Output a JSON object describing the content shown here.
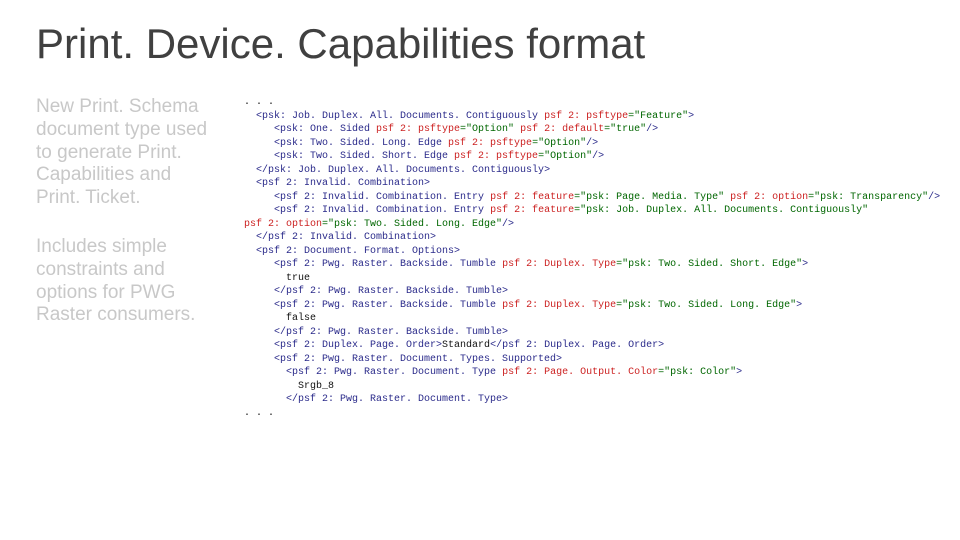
{
  "title": "Print. Device. Capabilities format",
  "left": {
    "p1": "New Print. Schema document type used to generate Print. Capabilities and Print. Ticket.",
    "p2": "Includes simple constraints and options for PWG Raster consumers."
  },
  "code": {
    "l00": ". . .",
    "l01_open": "<psk: Job. Duplex. All. Documents. Contiguously",
    "l01_a1n": " psf 2: psftype",
    "l01_a1v": "=\"Feature\"",
    "l02_open": "<psk: One. Sided",
    "l02_a1n": " psf 2: psftype",
    "l02_a1v": "=\"Option\"",
    "l02_a2n": " psf 2: default",
    "l02_a2v": "=\"true\"",
    "l03_open": "<psk: Two. Sided. Long. Edge",
    "l03_a1n": " psf 2: psftype",
    "l03_a1v": "=\"Option\"",
    "l04_open": "<psk: Two. Sided. Short. Edge",
    "l04_a1n": " psf 2: psftype",
    "l04_a1v": "=\"Option\"",
    "l05": "</psk: Job. Duplex. All. Documents. Contiguously>",
    "l06": "<psf 2: Invalid. Combination>",
    "l07_open": "<psf 2: Invalid. Combination. Entry",
    "l07_a1n": " psf 2: feature",
    "l07_a1v": "=\"psk: Page. Media. Type\"",
    "l07_a2n": " psf 2: option",
    "l07_a2v": "=\"psk: Transparency\"",
    "l08_open": "<psf 2: Invalid. Combination. Entry",
    "l08_a1n": " psf 2: feature",
    "l08_a1v": "=\"psk: Job. Duplex. All. Documents. Contiguously\"",
    "l08b_a1n": "psf 2: option",
    "l08b_a1v": "=\"psk: Two. Sided. Long. Edge\"",
    "l09": "</psf 2: Invalid. Combination>",
    "l10": "<psf 2: Document. Format. Options>",
    "l11_open": "<psf 2: Pwg. Raster. Backside. Tumble",
    "l11_a1n": " psf 2: Duplex. Type",
    "l11_a1v": "=\"psk: Two. Sided. Short. Edge\"",
    "l12": "true",
    "l13": "</psf 2: Pwg. Raster. Backside. Tumble>",
    "l14_open": "<psf 2: Pwg. Raster. Backside. Tumble",
    "l14_a1n": " psf 2: Duplex. Type",
    "l14_a1v": "=\"psk: Two. Sided. Long. Edge\"",
    "l15": "false",
    "l16": "</psf 2: Pwg. Raster. Backside. Tumble>",
    "l17_o": "<psf 2: Duplex. Page. Order>",
    "l17_t": "Standard",
    "l17_c": "</psf 2: Duplex. Page. Order>",
    "l18": "<psf 2: Pwg. Raster. Document. Types. Supported>",
    "l19_open": "<psf 2: Pwg. Raster. Document. Type",
    "l19_a1n": " psf 2: Page. Output. Color",
    "l19_a1v": "=\"psk: Color\"",
    "l20": "Srgb_8",
    "l21": "</psf 2: Pwg. Raster. Document. Type>",
    "l22": ". . ."
  }
}
